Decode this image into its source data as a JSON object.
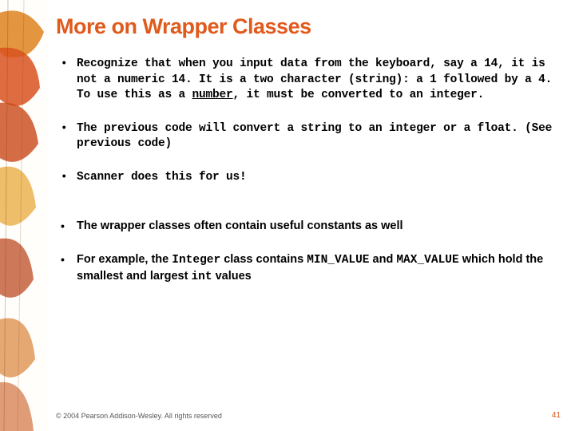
{
  "title": "More on Wrapper Classes",
  "b1": {
    "pre": "Recognize that when you input data from the keyboard, say a 14, it is not a numeric 14.  It is a two character (string): a 1 followed by a 4.  To use this as a ",
    "u": "number",
    "post": ", it must be converted to an integer."
  },
  "b2": "The previous code will convert a string to an integer or a float.  (See previous code)",
  "b3": "Scanner does this for us!",
  "b4": "The wrapper classes often contain useful constants as well",
  "b5": {
    "p1": "For example, the ",
    "c1": "Integer",
    "p2": " class contains ",
    "c2": "MIN_VALUE",
    "p3": " and ",
    "c3": "MAX_VALUE",
    "p4": " which hold the smallest and largest ",
    "c4": "int",
    "p5": " values"
  },
  "footer": "© 2004 Pearson Addison-Wesley. All rights reserved",
  "page": "41"
}
